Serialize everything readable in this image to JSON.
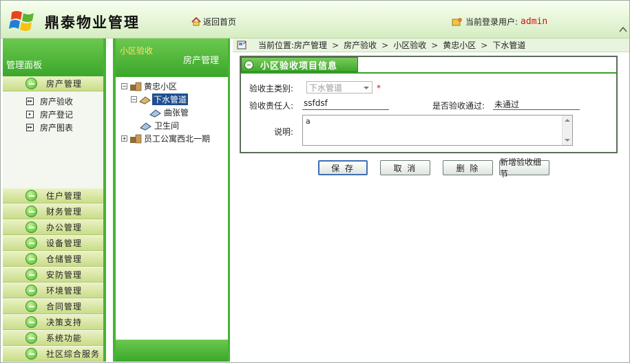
{
  "header": {
    "app_title": "鼎泰物业管理",
    "home_link": "返回首页",
    "user_label": "当前登录用户:",
    "user_name": "admin"
  },
  "left_panel": {
    "title": "管理面板",
    "top_menu": "房产管理",
    "submenu": [
      {
        "label": "房产验收",
        "icon": "expand-box-icon"
      },
      {
        "label": "房产登记",
        "icon": "expand-box-icon"
      },
      {
        "label": "房产图表",
        "icon": "expand-box-icon"
      }
    ],
    "menus": [
      "住户管理",
      "财务管理",
      "办公管理",
      "设备管理",
      "仓储管理",
      "安防管理",
      "环境管理",
      "合同管理",
      "决策支持",
      "系统功能",
      "社区综合服务"
    ]
  },
  "tree_panel": {
    "tab_label": "小区验收",
    "title": "房产管理",
    "nodes": [
      {
        "label": "黄忠小区",
        "toggle": "-",
        "icon": "building-icon"
      },
      {
        "label": "下水管道",
        "toggle": "-",
        "icon": "pipe-icon",
        "selected": true
      },
      {
        "label": "曲张管",
        "toggle": "",
        "icon": "pipe-icon"
      },
      {
        "label": "卫生间",
        "toggle": "",
        "icon": "pipe-icon"
      },
      {
        "label": "员工公寓西北一期",
        "toggle": "+",
        "icon": "building-icon"
      }
    ]
  },
  "breadcrumb": {
    "prefix": "当前位置:",
    "items": [
      "房产管理",
      "房产验收",
      "小区验收",
      "黄忠小区",
      "下水管道"
    ]
  },
  "form": {
    "tab_title": "小区验收项目信息",
    "type_label": "验收主类别:",
    "type_value": "下水管道",
    "required_mark": "*",
    "person_label": "验收责任人:",
    "person_value": "ssfdsf",
    "passed_label": "是否验收通过:",
    "passed_value": "未通过",
    "remark_label": "说明:",
    "remark_value": "a"
  },
  "buttons": {
    "save": "保 存",
    "cancel": "取 消",
    "delete": "删 除",
    "add_detail": "新增验收细节"
  },
  "colors": {
    "accent_green": "#46b433",
    "header_bg": "#e4f4d5",
    "selected_node": "#1f4f90",
    "user_name": "#d01010"
  }
}
